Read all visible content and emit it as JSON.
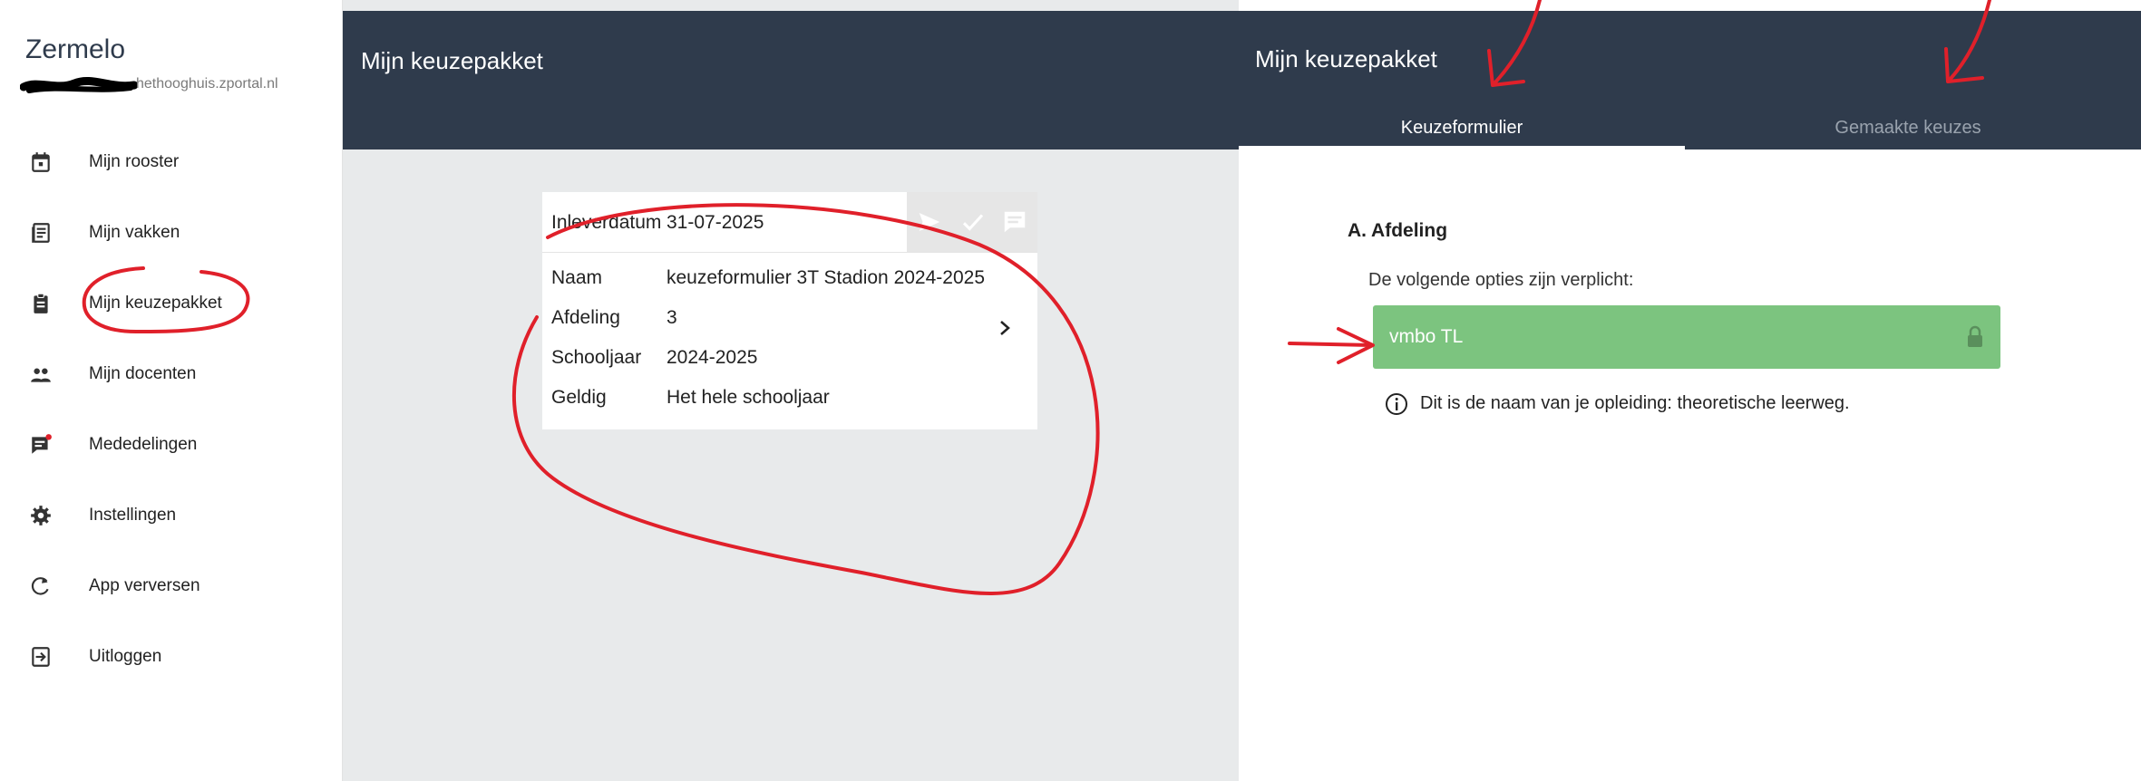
{
  "sidebar": {
    "brand": "Zermelo",
    "portal_url": "hethooghuis.zportal.nl",
    "items": [
      {
        "label": "Mijn rooster",
        "icon": "calendar-icon"
      },
      {
        "label": "Mijn vakken",
        "icon": "book-icon"
      },
      {
        "label": "Mijn keuzepakket",
        "icon": "clipboard-icon"
      },
      {
        "label": "Mijn docenten",
        "icon": "people-icon"
      },
      {
        "label": "Mededelingen",
        "icon": "announcement-icon"
      },
      {
        "label": "Instellingen",
        "icon": "gear-icon"
      },
      {
        "label": "App verversen",
        "icon": "refresh-icon"
      },
      {
        "label": "Uitloggen",
        "icon": "logout-icon"
      }
    ]
  },
  "middle": {
    "title": "Mijn keuzepakket",
    "card": {
      "deadline_label": "Inleverdatum",
      "deadline_value": "31-07-2025",
      "action_icons": [
        "send-icon",
        "check-icon",
        "comment-icon"
      ],
      "rows": [
        {
          "label": "Naam",
          "value": "keuzeformulier 3T Stadion 2024-2025"
        },
        {
          "label": "Afdeling",
          "value": "3"
        },
        {
          "label": "Schooljaar",
          "value": "2024-2025"
        },
        {
          "label": "Geldig",
          "value": "Het hele schooljaar"
        }
      ]
    }
  },
  "right": {
    "title": "Mijn keuzepakket",
    "tabs": [
      {
        "label": "Keuzeformulier",
        "active": true
      },
      {
        "label": "Gemaakte keuzes",
        "active": false
      }
    ],
    "section_title": "A. Afdeling",
    "required_text": "De volgende opties zijn verplicht:",
    "option": {
      "label": "vmbo TL",
      "locked": true
    },
    "info_text": "Dit is de naam van je opleiding: theoretische leerweg."
  },
  "colors": {
    "header": "#2f3b4c",
    "option_green": "#7cc47f",
    "annotation_red": "#e0202a",
    "panel_gray": "#e8eaeb"
  }
}
